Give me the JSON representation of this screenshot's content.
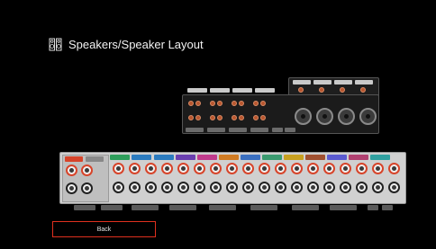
{
  "header": {
    "title": "Speakers/Speaker Layout",
    "icon": "speaker-pair-icon"
  },
  "footer": {
    "back_label": "Back"
  },
  "colors": {
    "accent": "#e0301e",
    "terminal_red": "#d7442a",
    "panel": "#d0d0d0"
  }
}
